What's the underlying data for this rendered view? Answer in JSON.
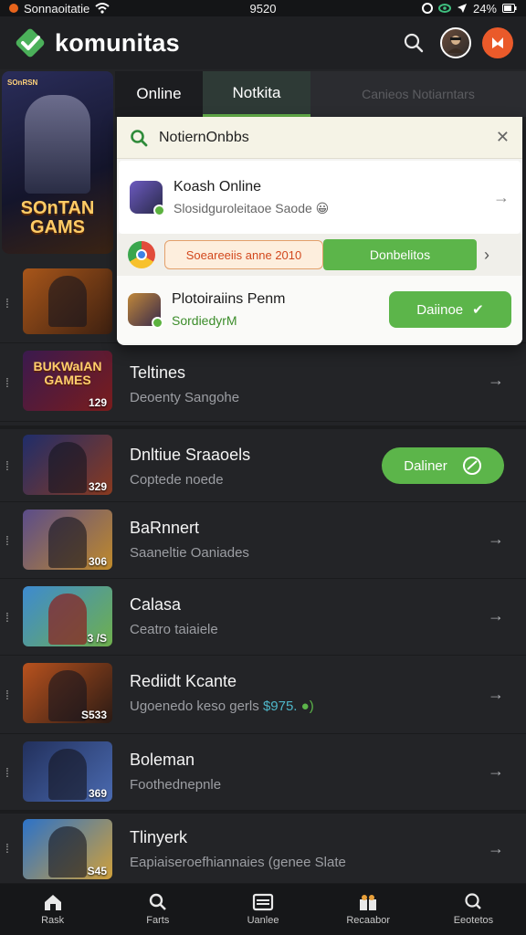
{
  "status_bar": {
    "carrier": "Sonnaoitatie",
    "time": "9520",
    "battery": "24%"
  },
  "app": {
    "title": "komunitas"
  },
  "sidebar": {
    "tag": "SOnRSN",
    "art_title": "SOnTAN\nGAMS"
  },
  "tabs": [
    {
      "label": "Online"
    },
    {
      "label": "Notkita",
      "active": true
    },
    {
      "label": "Canieos Notiarntars"
    }
  ],
  "popup": {
    "search_value": "NotiernOnbbs",
    "items": [
      {
        "title": "Koash Online",
        "subtitle": "Slosidguroleitaoe Saode 😀"
      },
      {
        "chip": "Soeareeiis anne 2010",
        "button": "Donbelitos"
      },
      {
        "title": "Plotoiraiins Penm",
        "subtitle": "SordiedyrM",
        "button": "Daiinoe"
      }
    ]
  },
  "list": [
    {
      "title": "Teltines",
      "subtitle": "Deoenty Sangohe",
      "thumb_text": "BUKWaIAN\nGAMES",
      "num": "129"
    },
    {
      "title": "Dnltiue Sraaoels",
      "subtitle": "Coptede noede",
      "num": "329",
      "button": "Daliner"
    },
    {
      "title": "BaRnnert",
      "subtitle": "Saaneltie Oaniades",
      "num": "306"
    },
    {
      "title": "Calasa",
      "subtitle": "Ceatro taiaiele",
      "num": "3 /S"
    },
    {
      "title": "Rediidt Kcante",
      "subtitle_main": "Ugoenedo keso gerls ",
      "subtitle_hl": "$975.",
      "num": "S533"
    },
    {
      "title": "Boleman",
      "subtitle": "Foothednepnle",
      "num": "369"
    },
    {
      "title": "Tlinyerk",
      "subtitle": "Eapiaiseroefhiannaies (genee Slate",
      "num": "S45"
    }
  ],
  "bottom_nav": [
    {
      "label": "Rask"
    },
    {
      "label": "Farts"
    },
    {
      "label": "Uanlee"
    },
    {
      "label": "Recaabor"
    },
    {
      "label": "Eeotetos"
    }
  ],
  "colors": {
    "accent_green": "#5cb54a",
    "notif_orange": "#ea5a2a",
    "bg": "#232427"
  },
  "icons": [
    "check-logo-icon",
    "search-icon",
    "avatar",
    "notification-icon",
    "close-icon",
    "chevron-right-icon",
    "home-icon",
    "magnify-icon",
    "layers-icon",
    "gift-icon",
    "search-nav-icon"
  ]
}
